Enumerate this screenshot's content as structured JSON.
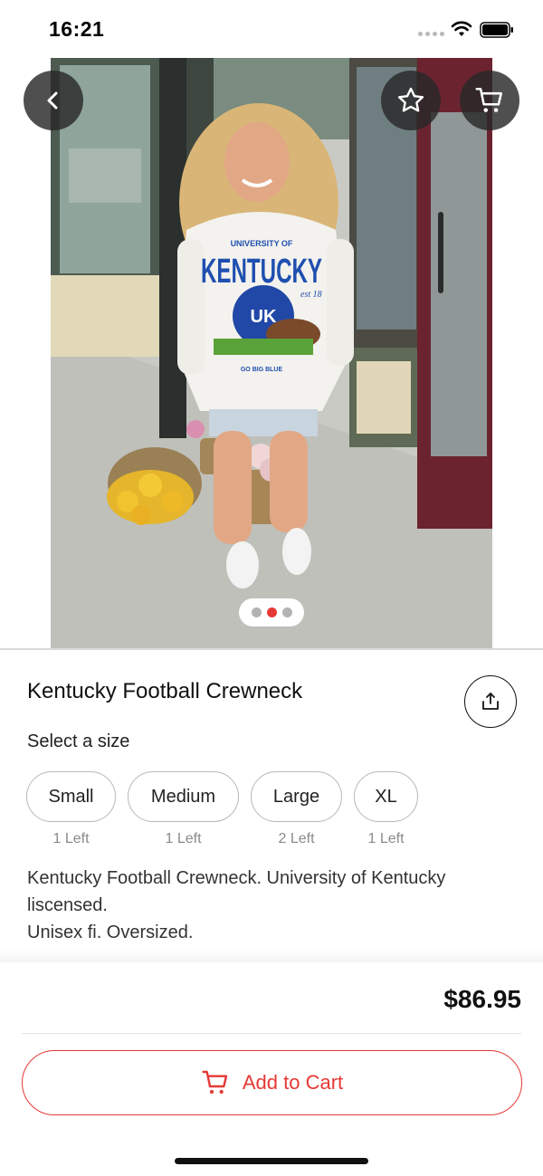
{
  "status_bar": {
    "time": "16:21"
  },
  "product": {
    "title": "Kentucky Football Crewneck",
    "size_prompt": "Select a size",
    "sizes": [
      {
        "label": "Small",
        "stock": "1 Left"
      },
      {
        "label": "Medium",
        "stock": "1 Left"
      },
      {
        "label": "Large",
        "stock": "2 Left"
      },
      {
        "label": "XL",
        "stock": "1 Left"
      }
    ],
    "description_line1": "Kentucky Football Crewneck. University of Kentucky liscensed.",
    "description_line2": "Unisex fi. Oversized.",
    "price": "$86.95"
  },
  "gallery": {
    "image_count": 3,
    "active_index": 1
  },
  "photo_text": {
    "university": "UNIVERSITY OF",
    "team": "KENTUCKY",
    "logo": "UK",
    "est": "est 18",
    "slogan": "GO BIG BLUE"
  },
  "actions": {
    "add_to_cart": "Add to Cart"
  },
  "icons": {
    "back": "chevron-left-icon",
    "favorite": "star-icon",
    "cart": "cart-icon",
    "share": "share-icon",
    "add_cart": "cart-icon"
  },
  "colors": {
    "accent": "#e53935",
    "text": "#1a1a1a",
    "muted": "#8a8a8a",
    "border": "#b8b8b8"
  }
}
